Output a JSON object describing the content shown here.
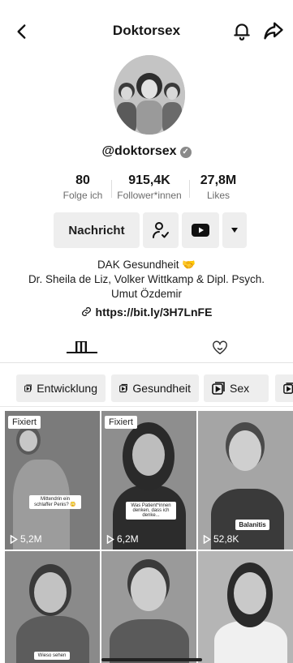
{
  "header": {
    "title": "Doktorsex"
  },
  "profile": {
    "handle": "@doktorsex",
    "stats": [
      {
        "value": "80",
        "label": "Folge ich"
      },
      {
        "value": "915,4K",
        "label": "Follower*innen"
      },
      {
        "value": "27,8M",
        "label": "Likes"
      }
    ],
    "message_label": "Nachricht",
    "bio_line1": "DAK Gesundheit 🤝",
    "bio_line2": "Dr. Sheila de Liz, Volker Wittkamp & Dipl. Psych.",
    "bio_line3": "Umut Özdemir",
    "link": "https://bit.ly/3H7LnFE"
  },
  "playlists": [
    {
      "label": "Entwicklung"
    },
    {
      "label": "Gesundheit"
    },
    {
      "label": "Sex"
    }
  ],
  "videos": [
    {
      "pinned": "Fixiert",
      "views": "5,2M",
      "caption": "Mittendrin ein schlaffer Penis? 😳"
    },
    {
      "pinned": "Fixiert",
      "views": "6,2M",
      "caption": "Was Patient*innen denken, dass ich denke..."
    },
    {
      "pinned": "",
      "views": "52,8K",
      "caption": "Balanitis"
    },
    {
      "pinned": "",
      "views": "",
      "caption": "Wieso sehen"
    },
    {
      "pinned": "",
      "views": "",
      "caption": ""
    },
    {
      "pinned": "",
      "views": "",
      "caption": ""
    }
  ],
  "icons": {
    "back": "chevron-left-icon",
    "bell": "bell-icon",
    "share": "share-icon",
    "verified": "verified-badge-icon",
    "follow": "user-check-icon",
    "youtube": "youtube-icon",
    "more": "caret-down-icon",
    "link": "link-icon",
    "grid_tab": "grid-icon",
    "liked_tab": "heart-hidden-icon",
    "playlist": "playlist-icon",
    "play": "play-icon"
  }
}
